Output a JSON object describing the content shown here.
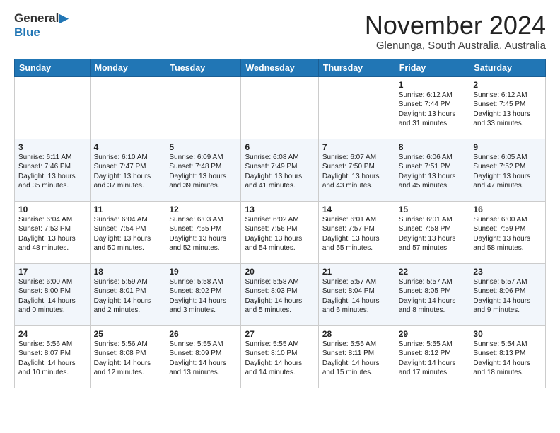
{
  "header": {
    "logo_line1": "General",
    "logo_line2": "Blue",
    "month": "November 2024",
    "location": "Glenunga, South Australia, Australia"
  },
  "days_of_week": [
    "Sunday",
    "Monday",
    "Tuesday",
    "Wednesday",
    "Thursday",
    "Friday",
    "Saturday"
  ],
  "weeks": [
    [
      {
        "day": "",
        "info": ""
      },
      {
        "day": "",
        "info": ""
      },
      {
        "day": "",
        "info": ""
      },
      {
        "day": "",
        "info": ""
      },
      {
        "day": "",
        "info": ""
      },
      {
        "day": "1",
        "info": "Sunrise: 6:12 AM\nSunset: 7:44 PM\nDaylight: 13 hours\nand 31 minutes."
      },
      {
        "day": "2",
        "info": "Sunrise: 6:12 AM\nSunset: 7:45 PM\nDaylight: 13 hours\nand 33 minutes."
      }
    ],
    [
      {
        "day": "3",
        "info": "Sunrise: 6:11 AM\nSunset: 7:46 PM\nDaylight: 13 hours\nand 35 minutes."
      },
      {
        "day": "4",
        "info": "Sunrise: 6:10 AM\nSunset: 7:47 PM\nDaylight: 13 hours\nand 37 minutes."
      },
      {
        "day": "5",
        "info": "Sunrise: 6:09 AM\nSunset: 7:48 PM\nDaylight: 13 hours\nand 39 minutes."
      },
      {
        "day": "6",
        "info": "Sunrise: 6:08 AM\nSunset: 7:49 PM\nDaylight: 13 hours\nand 41 minutes."
      },
      {
        "day": "7",
        "info": "Sunrise: 6:07 AM\nSunset: 7:50 PM\nDaylight: 13 hours\nand 43 minutes."
      },
      {
        "day": "8",
        "info": "Sunrise: 6:06 AM\nSunset: 7:51 PM\nDaylight: 13 hours\nand 45 minutes."
      },
      {
        "day": "9",
        "info": "Sunrise: 6:05 AM\nSunset: 7:52 PM\nDaylight: 13 hours\nand 47 minutes."
      }
    ],
    [
      {
        "day": "10",
        "info": "Sunrise: 6:04 AM\nSunset: 7:53 PM\nDaylight: 13 hours\nand 48 minutes."
      },
      {
        "day": "11",
        "info": "Sunrise: 6:04 AM\nSunset: 7:54 PM\nDaylight: 13 hours\nand 50 minutes."
      },
      {
        "day": "12",
        "info": "Sunrise: 6:03 AM\nSunset: 7:55 PM\nDaylight: 13 hours\nand 52 minutes."
      },
      {
        "day": "13",
        "info": "Sunrise: 6:02 AM\nSunset: 7:56 PM\nDaylight: 13 hours\nand 54 minutes."
      },
      {
        "day": "14",
        "info": "Sunrise: 6:01 AM\nSunset: 7:57 PM\nDaylight: 13 hours\nand 55 minutes."
      },
      {
        "day": "15",
        "info": "Sunrise: 6:01 AM\nSunset: 7:58 PM\nDaylight: 13 hours\nand 57 minutes."
      },
      {
        "day": "16",
        "info": "Sunrise: 6:00 AM\nSunset: 7:59 PM\nDaylight: 13 hours\nand 58 minutes."
      }
    ],
    [
      {
        "day": "17",
        "info": "Sunrise: 6:00 AM\nSunset: 8:00 PM\nDaylight: 14 hours\nand 0 minutes."
      },
      {
        "day": "18",
        "info": "Sunrise: 5:59 AM\nSunset: 8:01 PM\nDaylight: 14 hours\nand 2 minutes."
      },
      {
        "day": "19",
        "info": "Sunrise: 5:58 AM\nSunset: 8:02 PM\nDaylight: 14 hours\nand 3 minutes."
      },
      {
        "day": "20",
        "info": "Sunrise: 5:58 AM\nSunset: 8:03 PM\nDaylight: 14 hours\nand 5 minutes."
      },
      {
        "day": "21",
        "info": "Sunrise: 5:57 AM\nSunset: 8:04 PM\nDaylight: 14 hours\nand 6 minutes."
      },
      {
        "day": "22",
        "info": "Sunrise: 5:57 AM\nSunset: 8:05 PM\nDaylight: 14 hours\nand 8 minutes."
      },
      {
        "day": "23",
        "info": "Sunrise: 5:57 AM\nSunset: 8:06 PM\nDaylight: 14 hours\nand 9 minutes."
      }
    ],
    [
      {
        "day": "24",
        "info": "Sunrise: 5:56 AM\nSunset: 8:07 PM\nDaylight: 14 hours\nand 10 minutes."
      },
      {
        "day": "25",
        "info": "Sunrise: 5:56 AM\nSunset: 8:08 PM\nDaylight: 14 hours\nand 12 minutes."
      },
      {
        "day": "26",
        "info": "Sunrise: 5:55 AM\nSunset: 8:09 PM\nDaylight: 14 hours\nand 13 minutes."
      },
      {
        "day": "27",
        "info": "Sunrise: 5:55 AM\nSunset: 8:10 PM\nDaylight: 14 hours\nand 14 minutes."
      },
      {
        "day": "28",
        "info": "Sunrise: 5:55 AM\nSunset: 8:11 PM\nDaylight: 14 hours\nand 15 minutes."
      },
      {
        "day": "29",
        "info": "Sunrise: 5:55 AM\nSunset: 8:12 PM\nDaylight: 14 hours\nand 17 minutes."
      },
      {
        "day": "30",
        "info": "Sunrise: 5:54 AM\nSunset: 8:13 PM\nDaylight: 14 hours\nand 18 minutes."
      }
    ]
  ]
}
